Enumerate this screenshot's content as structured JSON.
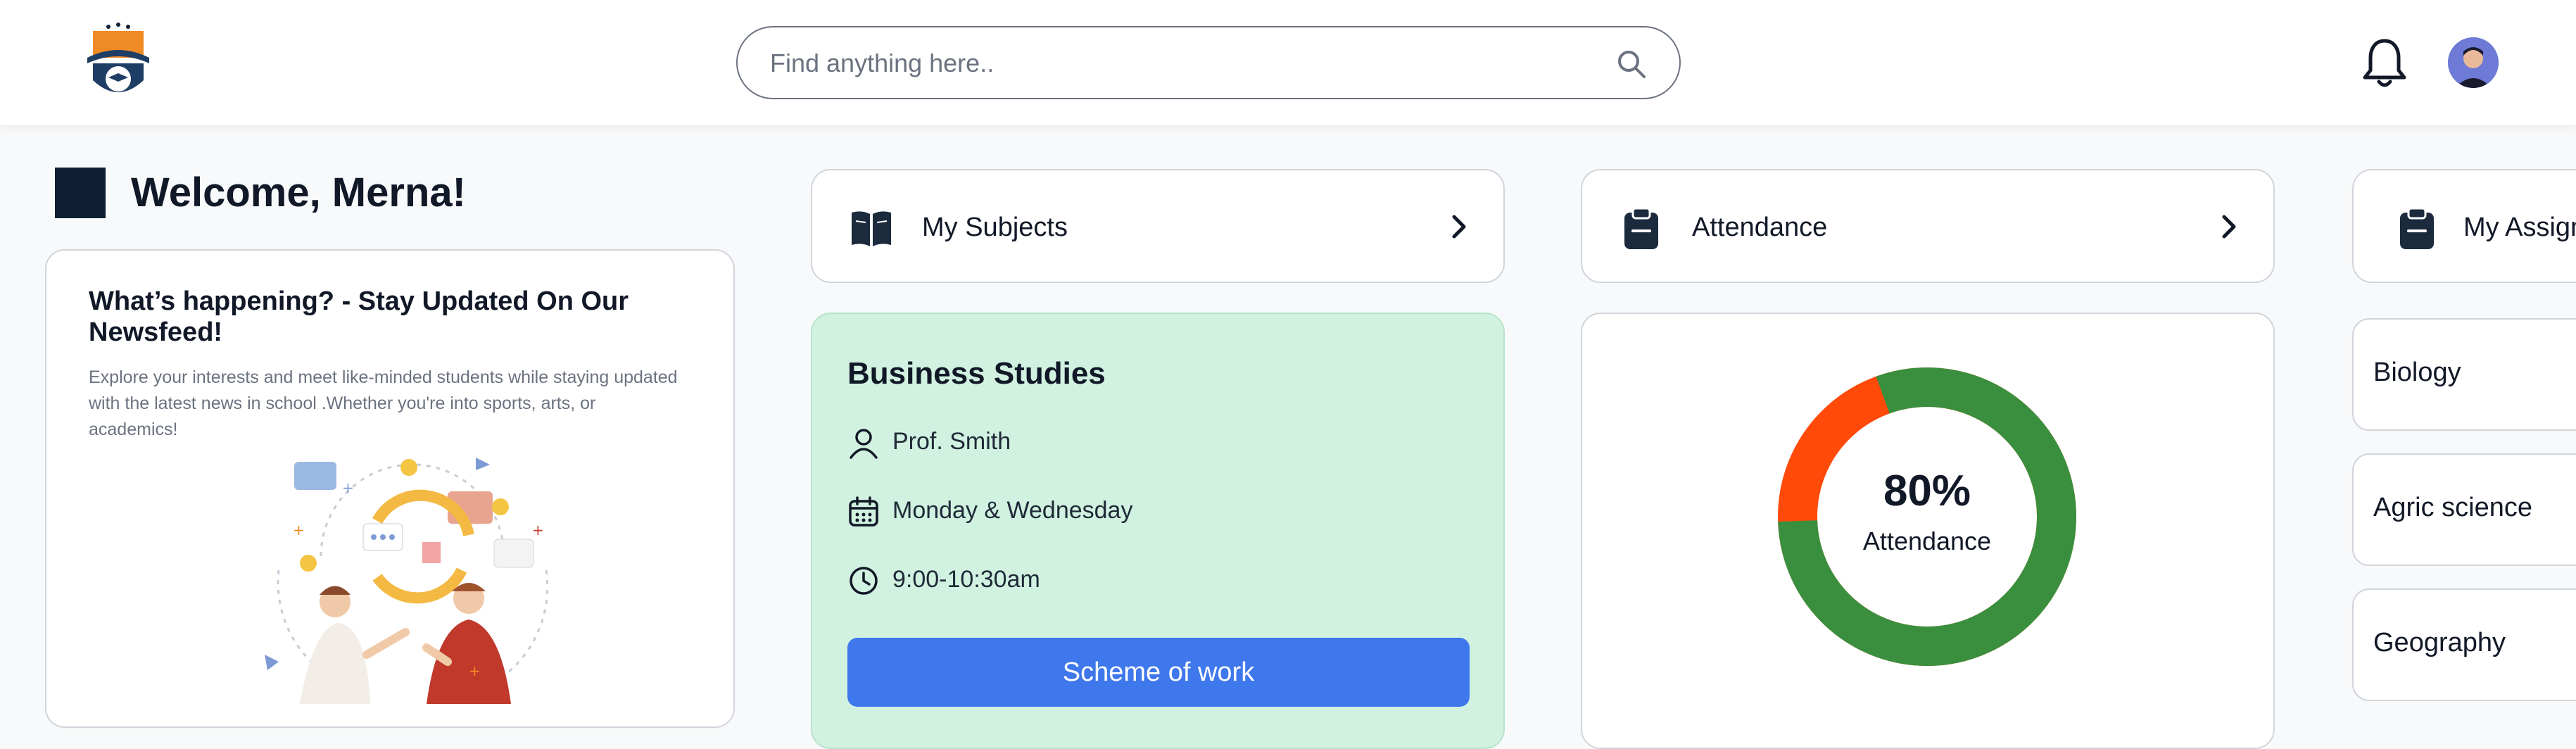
{
  "header": {
    "search": {
      "placeholder": "Find anything here.."
    }
  },
  "welcome": {
    "title": "Welcome, Merna!"
  },
  "newsfeed": {
    "title": "What’s happening? - Stay Updated On Our Newsfeed!",
    "description": "Explore your interests and meet like-minded students while staying updated with the latest news in  school .Whether you're into sports, arts, or academics!"
  },
  "nav_cards": [
    {
      "label": "My Subjects",
      "icon": "open-book-icon"
    },
    {
      "label": "Attendance",
      "icon": "clipboard-icon"
    },
    {
      "label": "My Assign",
      "icon": "clipboard-icon"
    }
  ],
  "subject": {
    "title": "Business Studies",
    "teacher": "Prof. Smith",
    "days": "Monday & Wednesday",
    "time": "9:00-10:30am",
    "button_label": "Scheme of work"
  },
  "attendance": {
    "percent_label": "80%",
    "label": "Attendance",
    "fraction": 0.8,
    "present_color": "#3a8f3e",
    "absent_color": "#ff4a0a"
  },
  "assignments": [
    "Biology",
    "Agric science",
    "Geography"
  ],
  "colors": {
    "accent_blue": "#3f78ec",
    "subject_bg": "#d1f2e0",
    "dark_navy": "#0f1f33"
  }
}
